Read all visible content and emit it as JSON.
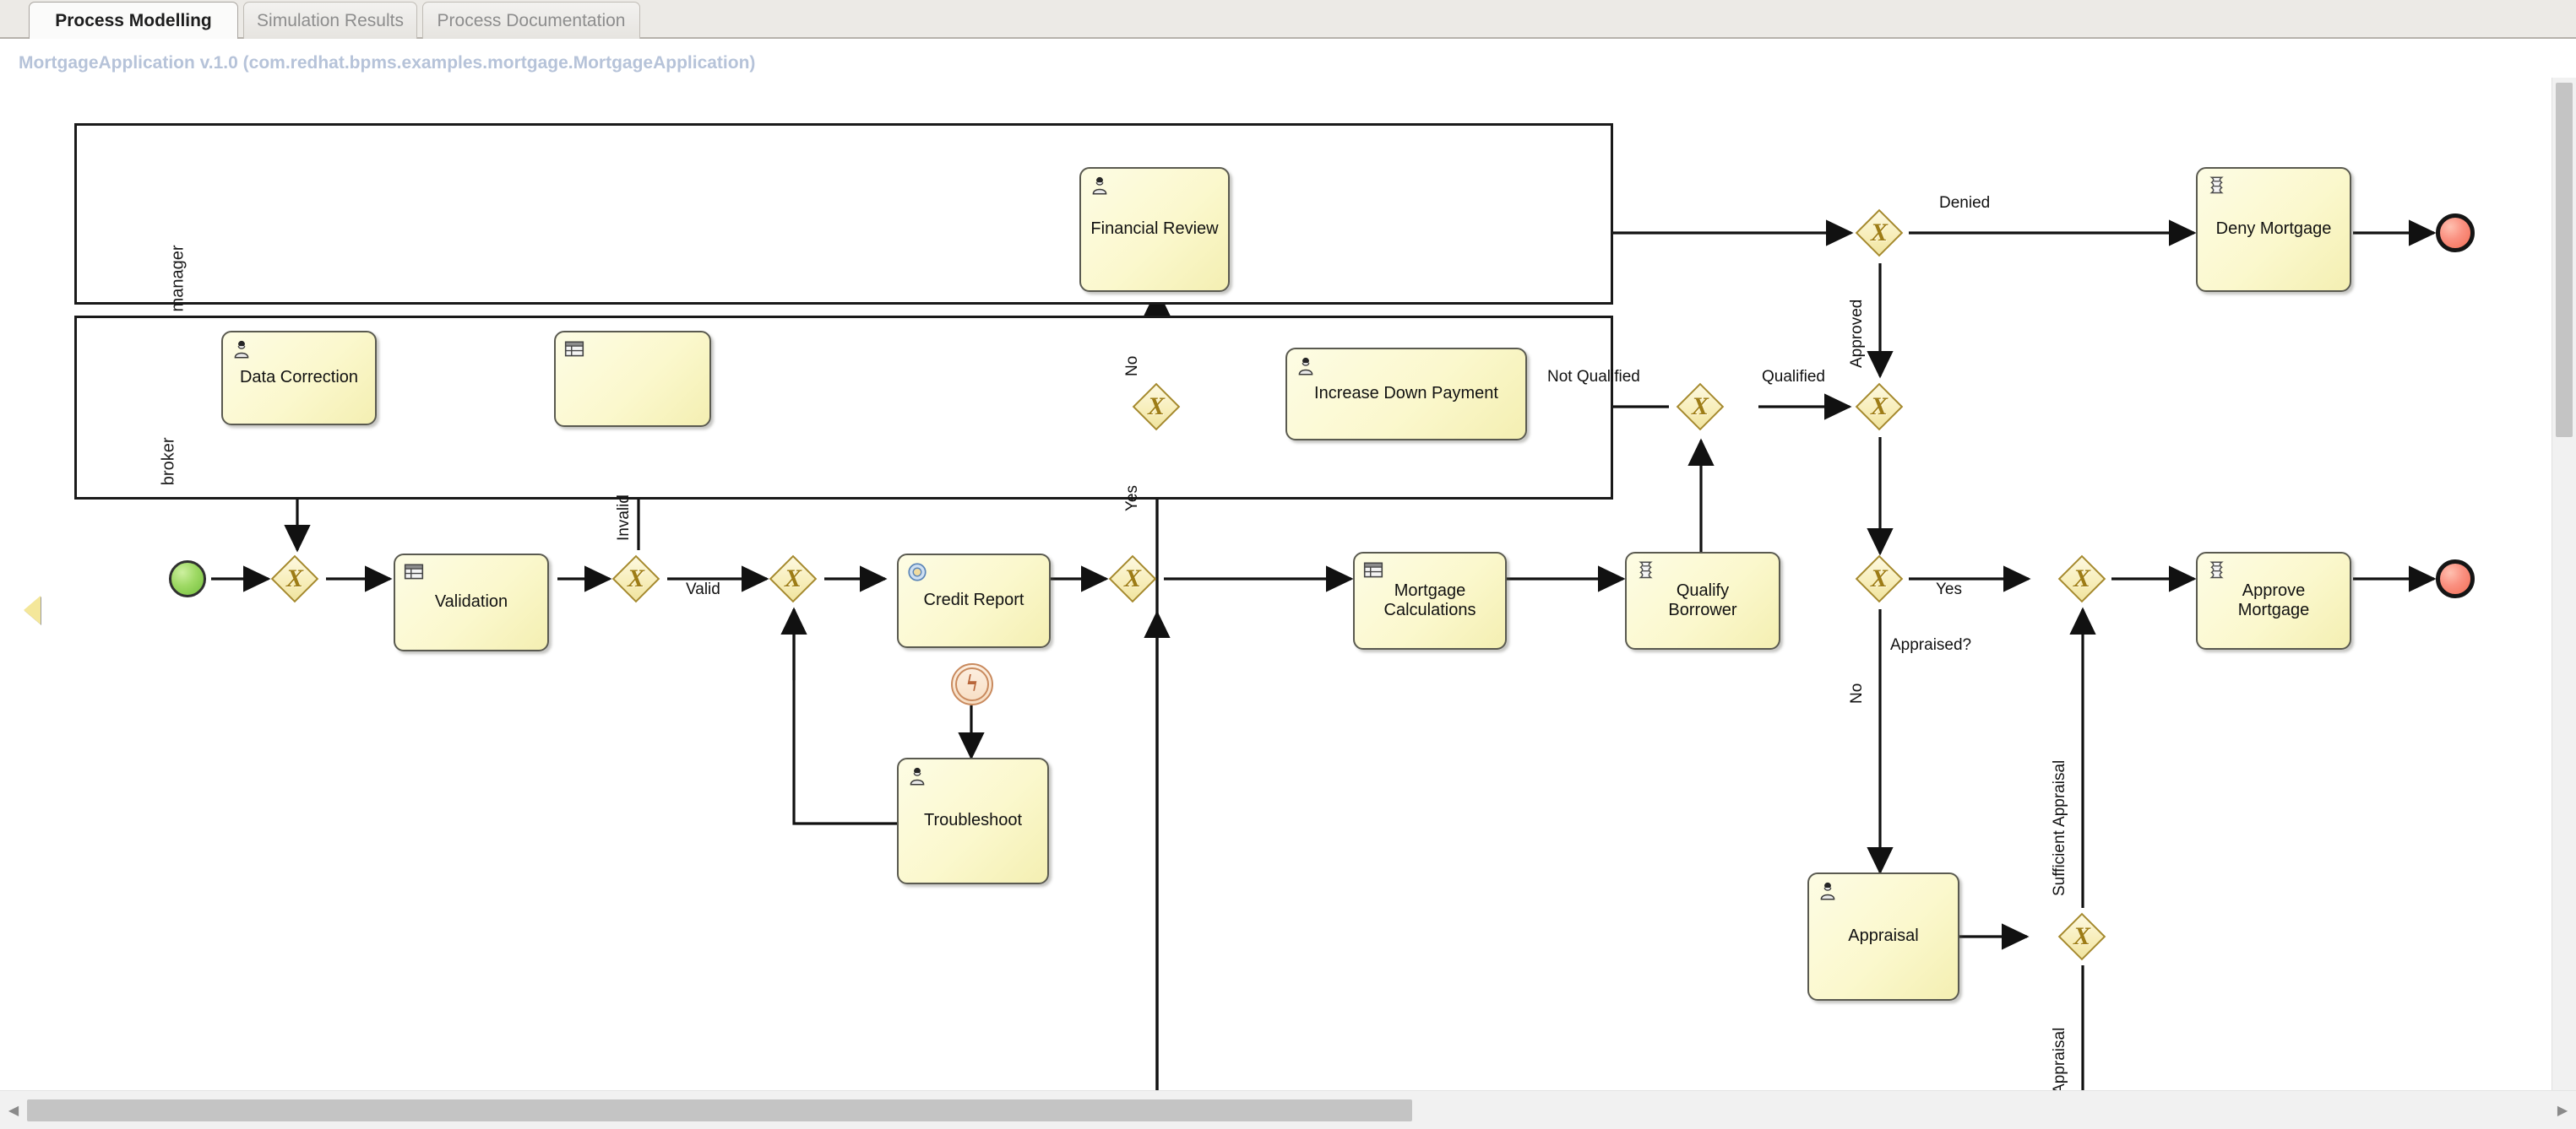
{
  "tabs": [
    {
      "label": "Process Modelling",
      "active": true
    },
    {
      "label": "Simulation Results",
      "active": false
    },
    {
      "label": "Process Documentation",
      "active": false
    }
  ],
  "diagram_title": "MortgageApplication v.1.0 (com.redhat.bpms.examples.mortgage.MortgageApplication)",
  "palette": {
    "toggle_icon": "triangle-left-icon"
  },
  "scrollbars": {
    "horizontal_left_arrow": "◀",
    "horizontal_right_arrow": "▶",
    "vertical_up_arrow": "▲",
    "vertical_down_arrow": "▼"
  },
  "lanes": [
    {
      "id": "manager",
      "label": "manager"
    },
    {
      "id": "broker",
      "label": "broker"
    }
  ],
  "nodes": {
    "start_event": {
      "label": "",
      "type": "start-event"
    },
    "gw_join_start": {
      "label": "",
      "type": "exclusive-gateway"
    },
    "validation": {
      "label": "Validation",
      "type": "business-rule-task"
    },
    "gw_valid": {
      "label": "",
      "type": "exclusive-gateway"
    },
    "gw_join_trouble": {
      "label": "",
      "type": "exclusive-gateway"
    },
    "credit_report": {
      "label": "Credit Report",
      "type": "service-task"
    },
    "credit_report_error": {
      "label": "",
      "type": "boundary-error-event"
    },
    "troubleshoot": {
      "label": "Troubleshoot",
      "type": "user-task"
    },
    "gw_after_credit": {
      "label": "",
      "type": "exclusive-gateway"
    },
    "mortgage_calculations": {
      "label": "Mortgage\nCalculations",
      "type": "business-rule-task"
    },
    "qualify_borrower": {
      "label": "Qualify\nBorrower",
      "type": "script-task"
    },
    "gw_qualified": {
      "label": "",
      "type": "exclusive-gateway"
    },
    "increase_down_payment": {
      "label": "Increase Down Payment",
      "type": "user-task"
    },
    "gw_review_loop": {
      "label": "",
      "type": "exclusive-gateway"
    },
    "financial_review": {
      "label": "Financial Review",
      "type": "user-task"
    },
    "gw_decision": {
      "label": "",
      "type": "exclusive-gateway"
    },
    "gw_merge_approved": {
      "label": "",
      "type": "exclusive-gateway"
    },
    "deny_mortgage": {
      "label": "Deny Mortgage",
      "type": "script-task"
    },
    "end_denied": {
      "label": "",
      "type": "end-event"
    },
    "gw_appraised": {
      "label": "",
      "type": "exclusive-gateway"
    },
    "appraisal": {
      "label": "Appraisal",
      "type": "user-task"
    },
    "gw_appraisal_result": {
      "label": "",
      "type": "exclusive-gateway"
    },
    "gw_merge_approve": {
      "label": "",
      "type": "exclusive-gateway"
    },
    "approve_mortgage": {
      "label": "Approve\nMortgage",
      "type": "script-task"
    },
    "end_approved": {
      "label": "",
      "type": "end-event"
    }
  },
  "flow_labels": {
    "invalid": "Invalid",
    "valid": "Valid",
    "no_review": "No",
    "yes_review": "Yes",
    "not_qualified": "Not Qualified",
    "qualified": "Qualified",
    "denied": "Denied",
    "approved": "Approved",
    "yes_appraised": "Yes",
    "no_appraised": "No",
    "appraised_question": "Appraised?",
    "sufficient_appraisal": "Sufficient Appraisal",
    "low_appraisal": "Low Appraisal"
  },
  "colors": {
    "task_fill": "#fbf8cd",
    "task_border": "#5a5a50",
    "gateway_fill": "#f7edb8",
    "gateway_border": "#a5892c",
    "start_event": "#9ed964",
    "end_event": "#fa9080",
    "title_text": "#b6c3d9",
    "flow_line": "#111111"
  }
}
